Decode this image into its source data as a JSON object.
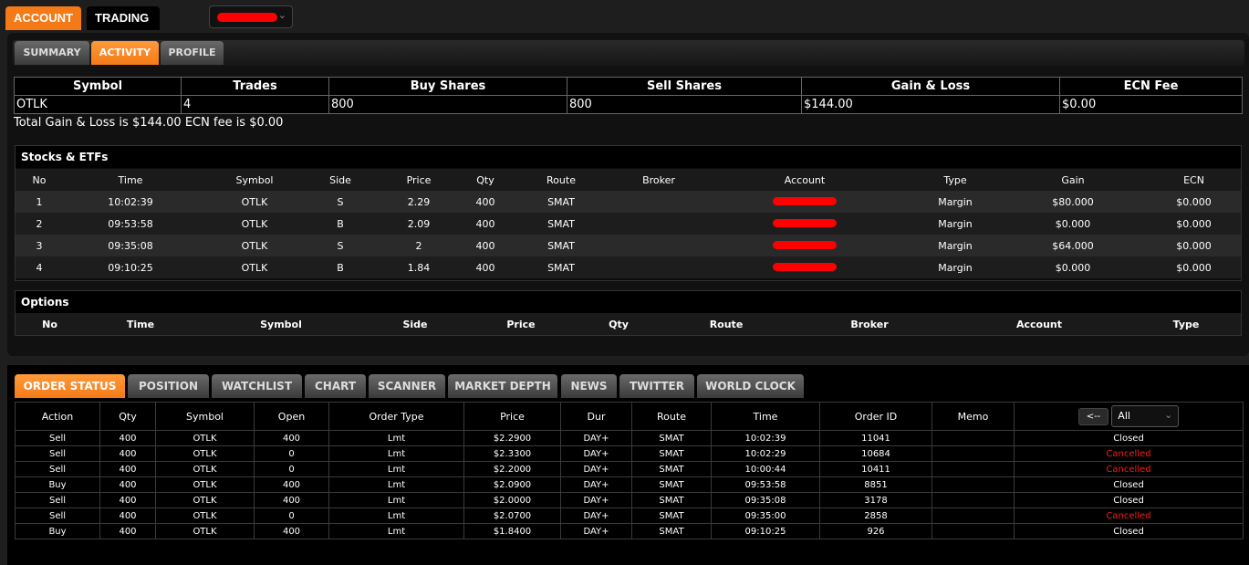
{
  "top_tabs": [
    "ACCOUNT",
    "TRADING"
  ],
  "account_tabs": [
    "SUMMARY",
    "ACTIVITY",
    "PROFILE"
  ],
  "summary": {
    "headers": [
      "Symbol",
      "Trades",
      "Buy Shares",
      "Sell Shares",
      "Gain & Loss",
      "ECN Fee"
    ],
    "row": [
      "OTLK",
      "4",
      "800",
      "800",
      "$144.00",
      "$0.00"
    ],
    "total_text": "Total Gain & Loss is $144.00 ECN fee is $0.00"
  },
  "stocks": {
    "title": "Stocks & ETFs",
    "headers": [
      "No",
      "Time",
      "Symbol",
      "Side",
      "Price",
      "Qty",
      "Route",
      "Broker",
      "Account",
      "Type",
      "Gain",
      "ECN"
    ],
    "rows": [
      [
        "1",
        "10:02:39",
        "OTLK",
        "S",
        "2.29",
        "400",
        "SMAT",
        "",
        "",
        "Margin",
        "$80.000",
        "$0.000"
      ],
      [
        "2",
        "09:53:58",
        "OTLK",
        "B",
        "2.09",
        "400",
        "SMAT",
        "",
        "",
        "Margin",
        "$0.000",
        "$0.000"
      ],
      [
        "3",
        "09:35:08",
        "OTLK",
        "S",
        "2",
        "400",
        "SMAT",
        "",
        "",
        "Margin",
        "$64.000",
        "$0.000"
      ],
      [
        "4",
        "09:10:25",
        "OTLK",
        "B",
        "1.84",
        "400",
        "SMAT",
        "",
        "",
        "Margin",
        "$0.000",
        "$0.000"
      ]
    ]
  },
  "options": {
    "title": "Options",
    "headers": [
      "No",
      "Time",
      "Symbol",
      "Side",
      "Price",
      "Qty",
      "Route",
      "Broker",
      "Account",
      "Type"
    ]
  },
  "bottom_tabs": [
    "ORDER STATUS",
    "POSITION",
    "WATCHLIST",
    "CHART",
    "SCANNER",
    "MARKET DEPTH",
    "NEWS",
    "TWITTER",
    "WORLD CLOCK"
  ],
  "orders": {
    "headers": [
      "Action",
      "Qty",
      "Symbol",
      "Open",
      "Order Type",
      "Price",
      "Dur",
      "Route",
      "Time",
      "Order ID",
      "Memo"
    ],
    "back_label": "<--",
    "filter_value": "All",
    "rows": [
      [
        "Sell",
        "400",
        "OTLK",
        "400",
        "Lmt",
        "$2.2900",
        "DAY+",
        "SMAT",
        "10:02:39",
        "11041",
        "",
        "Closed"
      ],
      [
        "Sell",
        "400",
        "OTLK",
        "0",
        "Lmt",
        "$2.3300",
        "DAY+",
        "SMAT",
        "10:02:29",
        "10684",
        "",
        "Cancelled"
      ],
      [
        "Sell",
        "400",
        "OTLK",
        "0",
        "Lmt",
        "$2.2000",
        "DAY+",
        "SMAT",
        "10:00:44",
        "10411",
        "",
        "Cancelled"
      ],
      [
        "Buy",
        "400",
        "OTLK",
        "400",
        "Lmt",
        "$2.0900",
        "DAY+",
        "SMAT",
        "09:53:58",
        "8851",
        "",
        "Closed"
      ],
      [
        "Sell",
        "400",
        "OTLK",
        "400",
        "Lmt",
        "$2.0000",
        "DAY+",
        "SMAT",
        "09:35:08",
        "3178",
        "",
        "Closed"
      ],
      [
        "Sell",
        "400",
        "OTLK",
        "0",
        "Lmt",
        "$2.0700",
        "DAY+",
        "SMAT",
        "09:35:00",
        "2858",
        "",
        "Cancelled"
      ],
      [
        "Buy",
        "400",
        "OTLK",
        "400",
        "Lmt",
        "$1.8400",
        "DAY+",
        "SMAT",
        "09:10:25",
        "926",
        "",
        "Closed"
      ]
    ]
  },
  "colors": {
    "accent": "#f47a17",
    "cancelled": "#f41d1d"
  }
}
